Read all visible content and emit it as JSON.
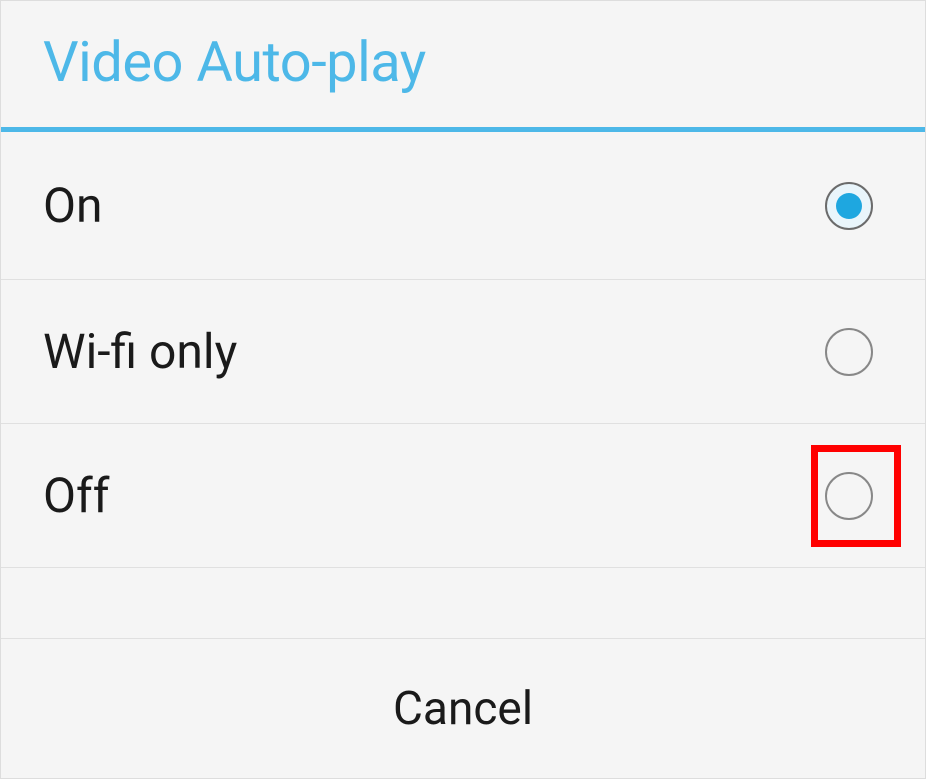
{
  "dialog": {
    "title": "Video Auto-play",
    "options": [
      {
        "label": "On",
        "selected": true,
        "highlighted": false
      },
      {
        "label": "Wi-fi only",
        "selected": false,
        "highlighted": false
      },
      {
        "label": "Off",
        "selected": false,
        "highlighted": true
      }
    ],
    "cancel_label": "Cancel"
  }
}
